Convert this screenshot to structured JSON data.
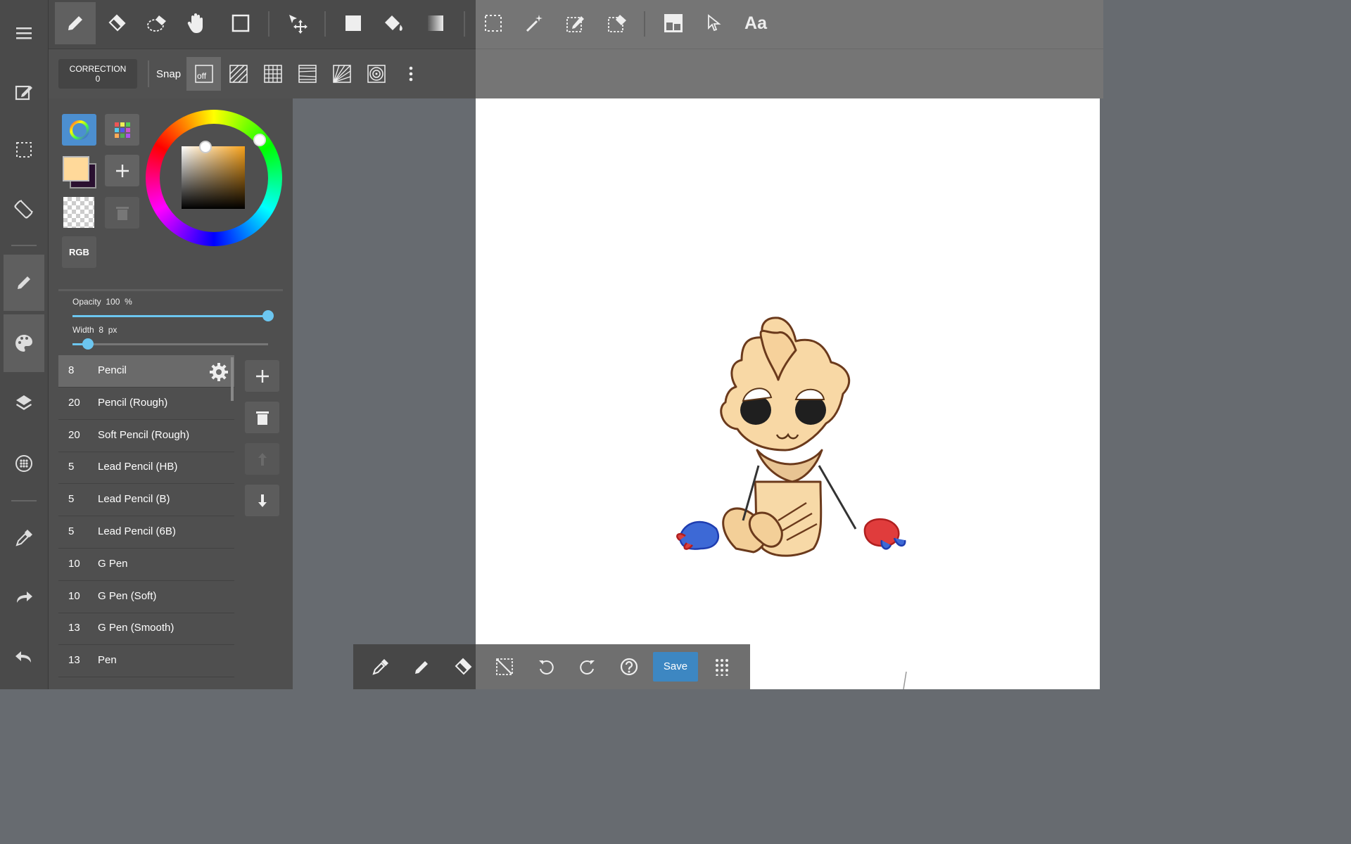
{
  "toolbar": {
    "tools": [
      "pen",
      "eraser",
      "lasso-eraser",
      "hand",
      "rectangle",
      "move",
      "fill-rect",
      "bucket",
      "gradient",
      "select-rect",
      "magic-wand",
      "select-pen",
      "select-eraser",
      "frame",
      "operation",
      "text"
    ],
    "text_tool_label": "Aa"
  },
  "snapbar": {
    "correction_label": "CORRECTION",
    "correction_value": "0",
    "snap_label": "Snap",
    "snap_off_label": "off"
  },
  "panel": {
    "color_mode_label": "RGB",
    "current_color": "#ffd99a",
    "secondary_color": "#2a1030",
    "opacity_label": "Opacity",
    "opacity_value": "100",
    "opacity_unit": "%",
    "opacity_level": 1.0,
    "width_label": "Width",
    "width_value": "8",
    "width_unit": "px",
    "width_level": 0.08,
    "brushes": [
      {
        "size": "8",
        "name": "Pencil"
      },
      {
        "size": "20",
        "name": "Pencil (Rough)"
      },
      {
        "size": "20",
        "name": "Soft Pencil (Rough)"
      },
      {
        "size": "5",
        "name": "Lead Pencil (HB)"
      },
      {
        "size": "5",
        "name": "Lead Pencil (B)"
      },
      {
        "size": "5",
        "name": "Lead Pencil (6B)"
      },
      {
        "size": "10",
        "name": "G Pen"
      },
      {
        "size": "10",
        "name": "G Pen (Soft)"
      },
      {
        "size": "13",
        "name": "G Pen (Smooth)"
      },
      {
        "size": "13",
        "name": "Pen"
      }
    ]
  },
  "bottombar": {
    "save_label": "Save"
  },
  "colors": {
    "accent": "#3d87c2",
    "slider": "#6cc6f0"
  }
}
